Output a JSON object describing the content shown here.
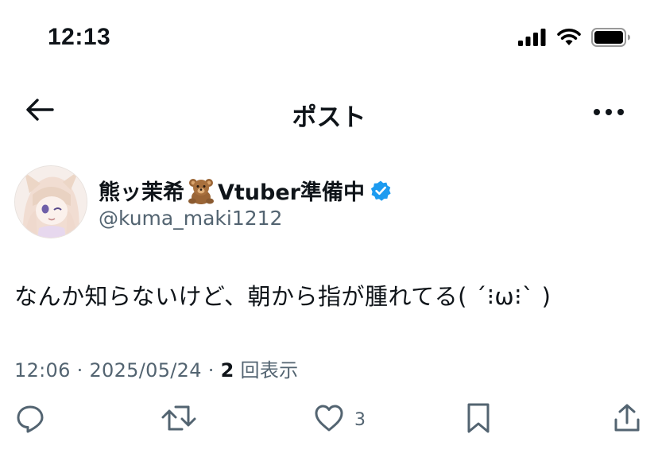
{
  "status_bar": {
    "time": "12:13"
  },
  "nav": {
    "title": "ポスト",
    "back_icon": "arrow-left-icon",
    "more_icon": "more-horizontal-icon"
  },
  "author": {
    "name_prefix": "熊ッ茉希",
    "name_suffix": "Vtuber準備中",
    "handle": "@kuma_maki1212",
    "verified_color": "#1d9bf0"
  },
  "post": {
    "text": "なんか知らないけど、朝から指が腫れてる( ´⁝ω⁝` )"
  },
  "meta": {
    "time": "12:06",
    "separator": " · ",
    "date": "2025/05/24",
    "views_count": "2",
    "views_label": "回表示"
  },
  "actions": {
    "reply_count": "",
    "repost_count": "",
    "like_count": "3"
  },
  "colors": {
    "text_primary": "#0f1419",
    "text_secondary": "#536471",
    "icon": "#536471"
  }
}
